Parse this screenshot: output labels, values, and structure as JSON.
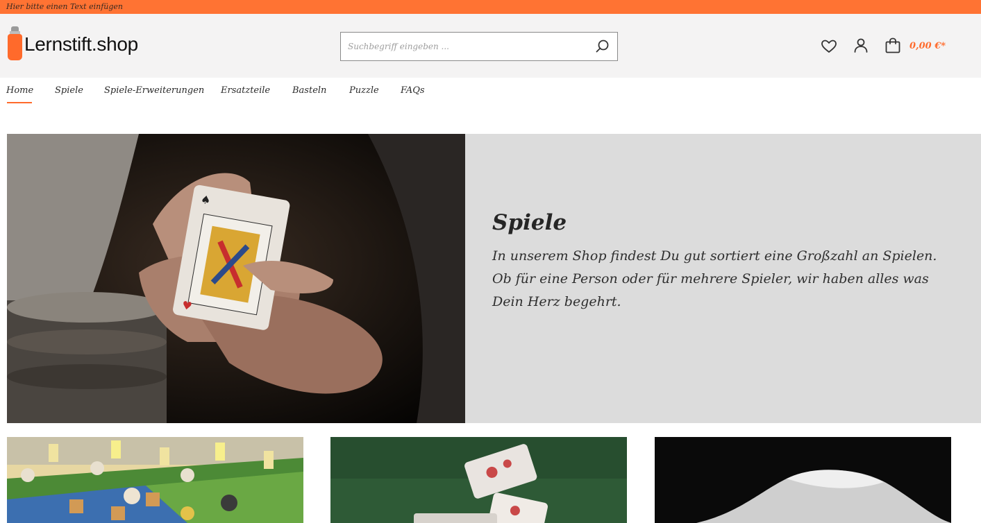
{
  "topbar": {
    "text": "Hier bitte einen Text einfügen"
  },
  "header": {
    "logo_text": "Lernstift.shop",
    "search": {
      "placeholder": "Suchbegriff eingeben ...",
      "value": ""
    },
    "cart": {
      "price": "0,00 €*"
    },
    "icons": [
      "wishlist-heart-icon",
      "account-user-icon",
      "cart-bag-icon",
      "search-icon"
    ]
  },
  "nav": {
    "items": [
      {
        "label": "Home",
        "active": true
      },
      {
        "label": "Spiele",
        "active": false
      },
      {
        "label": "Spiele-Erweiterungen",
        "active": false
      },
      {
        "label": "Ersatzteile",
        "active": false
      },
      {
        "label": "Basteln",
        "active": false
      },
      {
        "label": "Puzzle",
        "active": false
      },
      {
        "label": "FAQs",
        "active": false
      }
    ]
  },
  "hero": {
    "title": "Spiele",
    "text": "In unserem Shop findest Du gut sortiert eine Großzahl an Spielen. Ob für eine Person oder für mehrere Spieler, wir haben alles was Dein Herz begehrt."
  },
  "colors": {
    "accent": "#ff7333",
    "header_bg": "#f4f3f3",
    "hero_panel_bg": "#dcdcdc"
  }
}
